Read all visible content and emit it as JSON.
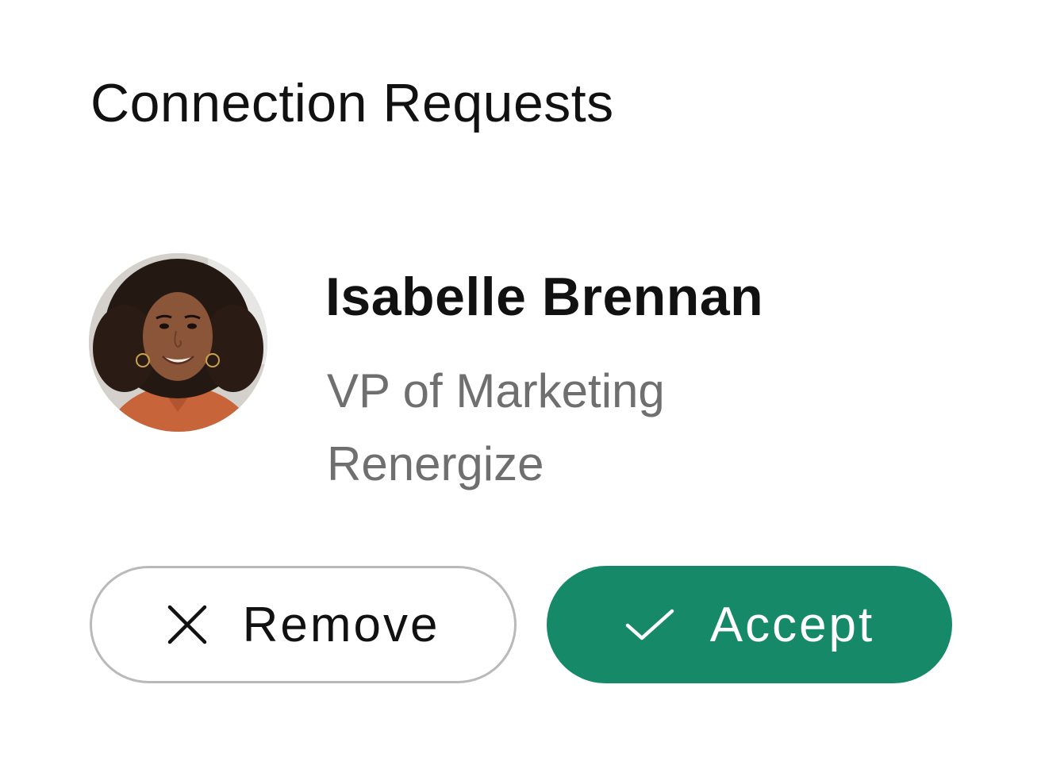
{
  "header": {
    "title": "Connection Requests"
  },
  "request": {
    "avatar": "avatar-photo",
    "name": "Isabelle Brennan",
    "role": "VP of Marketing",
    "company": "Renergize"
  },
  "actions": {
    "remove_label": "Remove",
    "remove_icon": "close-icon",
    "accept_label": "Accept",
    "accept_icon": "check-icon"
  },
  "colors": {
    "accent": "#168a68",
    "secondary_text": "#6f6f6f",
    "button_border": "#b9b9b9"
  }
}
